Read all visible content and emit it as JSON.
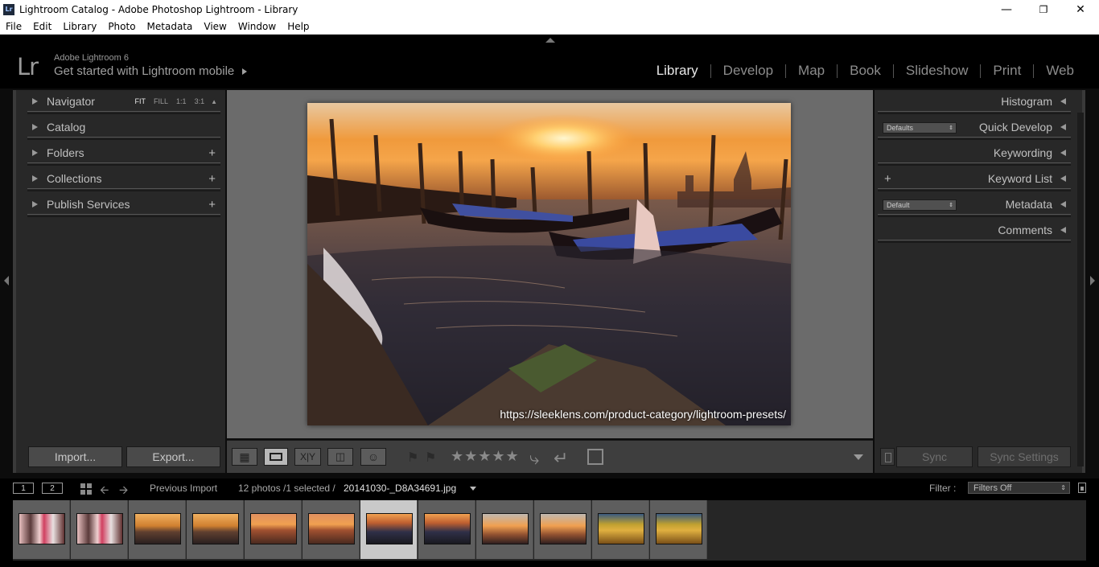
{
  "window": {
    "title": "Lightroom Catalog - Adobe Photoshop Lightroom - Library",
    "icon_text": "Lr",
    "minimize_icon": "minimize-icon",
    "maximize_icon": "restore-icon",
    "close_icon": "close-icon"
  },
  "menu": [
    "File",
    "Edit",
    "Library",
    "Photo",
    "Metadata",
    "View",
    "Window",
    "Help"
  ],
  "identity": {
    "logo": "Lr",
    "version": "Adobe Lightroom 6",
    "mobile": "Get started with Lightroom mobile"
  },
  "modules": [
    "Library",
    "Develop",
    "Map",
    "Book",
    "Slideshow",
    "Print",
    "Web"
  ],
  "active_module": "Library",
  "left_panel": {
    "navigator": {
      "label": "Navigator",
      "fit": "FIT",
      "fill": "FILL",
      "one": "1:1",
      "three": "3:1"
    },
    "catalog": "Catalog",
    "folders": "Folders",
    "collections": "Collections",
    "publish": "Publish Services",
    "plus": "+",
    "import_label": "Import...",
    "export_label": "Export..."
  },
  "right_panel": {
    "histogram": "Histogram",
    "quick_develop": "Quick Develop",
    "quick_develop_preset": "Defaults",
    "keywording": "Keywording",
    "keyword_list": "Keyword List",
    "metadata": "Metadata",
    "metadata_preset": "Default",
    "comments": "Comments",
    "plus": "+",
    "sync_label": "Sync",
    "sync_settings_label": "Sync Settings"
  },
  "photo": {
    "watermark": "https://sleeklens.com/product-category/lightroom-presets/"
  },
  "toolbar": {
    "stars": "★★★★★",
    "compare_label": "X|Y"
  },
  "filmstrip_bar": {
    "screen1": "1",
    "screen2": "2",
    "source": "Previous Import",
    "count": "12 photos /1 selected /",
    "filename": "20141030-_D8A34691.jpg",
    "filter_label": "Filter :",
    "filter_value": "Filters Off"
  },
  "filmstrip": {
    "selected_index": 6,
    "thumbs": [
      "portrait",
      "portrait",
      "venice-dock",
      "venice-dock",
      "venice-sunset",
      "venice-sunset",
      "gondolas",
      "gondolas",
      "gondola-sunset",
      "gondola-sunset",
      "autumn-vineyard",
      "autumn-vineyard"
    ]
  },
  "colors": {
    "accent_text": "#e8e8e8",
    "panel_bg": "#282828",
    "center_bg": "#6b6b6b"
  }
}
